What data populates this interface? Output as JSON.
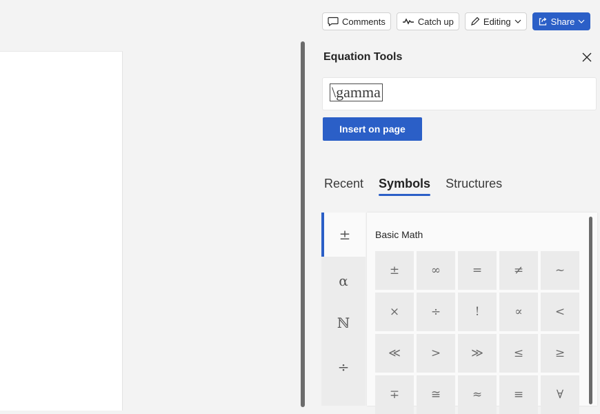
{
  "toolbar": {
    "comments": "Comments",
    "catch_up": "Catch up",
    "editing": "Editing",
    "share": "Share"
  },
  "panel": {
    "title": "Equation Tools",
    "equation_value": "\\gamma",
    "insert_label": "Insert on page",
    "tabs": [
      "Recent",
      "Symbols",
      "Structures"
    ],
    "active_tab": "Symbols"
  },
  "categories": [
    "±",
    "α",
    "ℕ",
    "÷"
  ],
  "selected_category": "±",
  "symbols": {
    "heading": "Basic Math",
    "rows": [
      [
        "±",
        "∞",
        "=",
        "≠",
        "~"
      ],
      [
        "×",
        "÷",
        "!",
        "∝",
        "<"
      ],
      [
        "≪",
        ">",
        "≫",
        "≤",
        "≥"
      ],
      [
        "∓",
        "≅",
        "≈",
        "≡",
        "∀"
      ]
    ]
  },
  "colors": {
    "accent": "#2b5fc7",
    "background": "#f3f3f3"
  }
}
